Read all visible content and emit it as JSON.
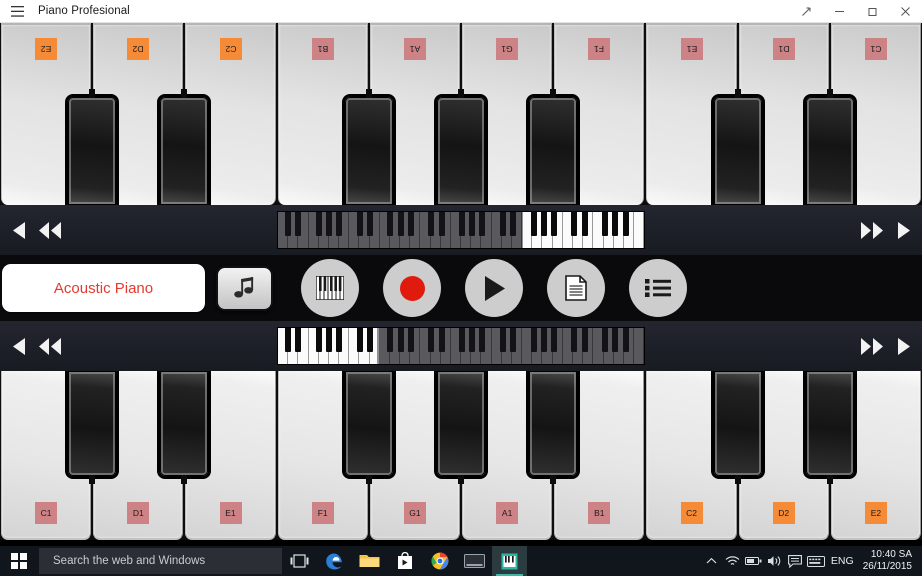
{
  "window": {
    "title": "Piano Profesional",
    "menu_icon": "hamburger-icon",
    "controls": {
      "restore_label": "↗",
      "minimize_label": "–",
      "maximize_label": "❐",
      "close_label": "✕"
    }
  },
  "top_keyboard": {
    "orientation": "inverted",
    "white_keys": [
      {
        "label": "E2",
        "color": "#f68b37"
      },
      {
        "label": "D2",
        "color": "#f68b37"
      },
      {
        "label": "C2",
        "color": "#f68b37"
      },
      {
        "label": "B1",
        "color": "#cd8285"
      },
      {
        "label": "A1",
        "color": "#cd8285"
      },
      {
        "label": "G1",
        "color": "#cd8285"
      },
      {
        "label": "F1",
        "color": "#cd8285"
      },
      {
        "label": "E1",
        "color": "#cd8285"
      },
      {
        "label": "D1",
        "color": "#cd8285"
      },
      {
        "label": "C1",
        "color": "#cd8285"
      }
    ]
  },
  "bottom_keyboard": {
    "orientation": "normal",
    "white_keys": [
      {
        "label": "C1",
        "color": "#cd8285"
      },
      {
        "label": "D1",
        "color": "#cd8285"
      },
      {
        "label": "E1",
        "color": "#cd8285"
      },
      {
        "label": "F1",
        "color": "#cd8285"
      },
      {
        "label": "G1",
        "color": "#cd8285"
      },
      {
        "label": "A1",
        "color": "#cd8285"
      },
      {
        "label": "B1",
        "color": "#cd8285"
      },
      {
        "label": "C2",
        "color": "#f68b37"
      },
      {
        "label": "D2",
        "color": "#f68b37"
      },
      {
        "label": "E2",
        "color": "#f68b37"
      }
    ]
  },
  "nav_top": {
    "prev_icon": "triangle-left-icon",
    "prev_fast_icon": "double-triangle-left-icon",
    "next_fast_icon": "double-triangle-right-icon",
    "next_icon": "triangle-right-icon",
    "overview_icon": "mini-keyboard-overview",
    "highlight_side": "right",
    "highlight_start_pct": 67,
    "highlight_width_pct": 33
  },
  "nav_bottom": {
    "prev_icon": "triangle-left-icon",
    "prev_fast_icon": "double-triangle-left-icon",
    "next_fast_icon": "double-triangle-right-icon",
    "next_icon": "triangle-right-icon",
    "overview_icon": "mini-keyboard-overview",
    "highlight_side": "left",
    "highlight_start_pct": 0,
    "highlight_width_pct": 27
  },
  "controls": {
    "instrument_name": "Acoustic Piano",
    "instrument_color": "#e23b2e",
    "note_button_icon": "music-note-icon",
    "buttons": [
      {
        "name": "keys-button",
        "icon": "piano-keys-icon"
      },
      {
        "name": "record-button",
        "icon": "record-dot-icon",
        "color": "#e01b0e"
      },
      {
        "name": "play-button",
        "icon": "play-triangle-icon"
      },
      {
        "name": "sheet-button",
        "icon": "document-icon"
      },
      {
        "name": "list-button",
        "icon": "list-icon"
      }
    ]
  },
  "taskbar": {
    "start_icon": "windows-logo-icon",
    "search_placeholder": "Search the web and Windows",
    "icons": [
      {
        "name": "task-view-icon"
      },
      {
        "name": "edge-icon"
      },
      {
        "name": "file-explorer-icon"
      },
      {
        "name": "store-icon"
      },
      {
        "name": "chrome-icon"
      },
      {
        "name": "terminal-icon"
      },
      {
        "name": "piano-app-icon"
      }
    ],
    "tray": {
      "chevron_icon": "chevron-up-icon",
      "network_icon": "wifi-icon",
      "battery_icon": "battery-icon",
      "volume_icon": "speaker-icon",
      "action_center_icon": "action-center-icon",
      "keyboard_icon": "keyboard-icon",
      "language": "ENG",
      "time": "10:40 SA",
      "date": "26/11/2015"
    }
  }
}
